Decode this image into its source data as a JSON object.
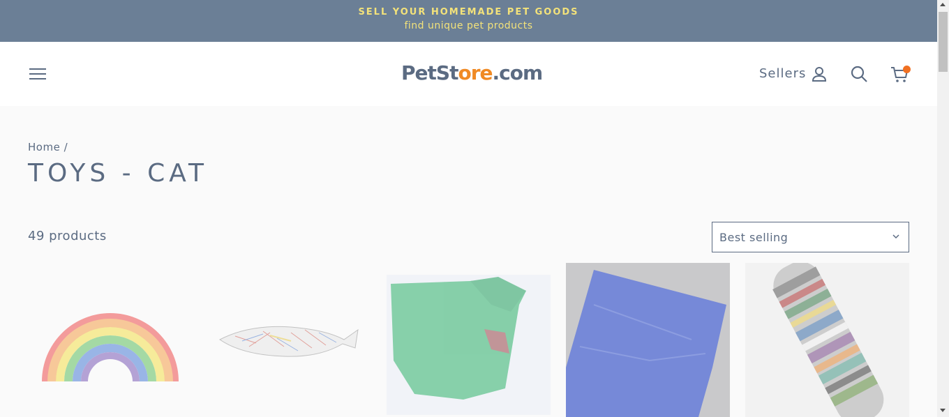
{
  "announcement": {
    "line1": "SELL YOUR HOMEMADE PET GOODS",
    "line2": "find unique pet products"
  },
  "header": {
    "logo_part1": "PetSt",
    "logo_part2": "o",
    "logo_part3": "re",
    "logo_part4": ".com",
    "sellers_label": "Sellers",
    "icons": [
      "menu-icon",
      "user-icon",
      "search-icon",
      "cart-icon"
    ]
  },
  "breadcrumb": {
    "home": "Home",
    "separator": "/"
  },
  "page_title": "TOYS - CAT",
  "product_count": "49 products",
  "sort": {
    "selected": "Best selling"
  },
  "products": [
    {
      "image": "rainbow-toy"
    },
    {
      "image": "fish-toy"
    },
    {
      "image": "green-blanket"
    },
    {
      "image": "blue-blanket"
    },
    {
      "image": "striped-kicker"
    }
  ],
  "colors": {
    "banner": "#6b7f96",
    "banner_text": "#f3e27a",
    "accent": "#f08a24",
    "text": "#5b6b82"
  }
}
